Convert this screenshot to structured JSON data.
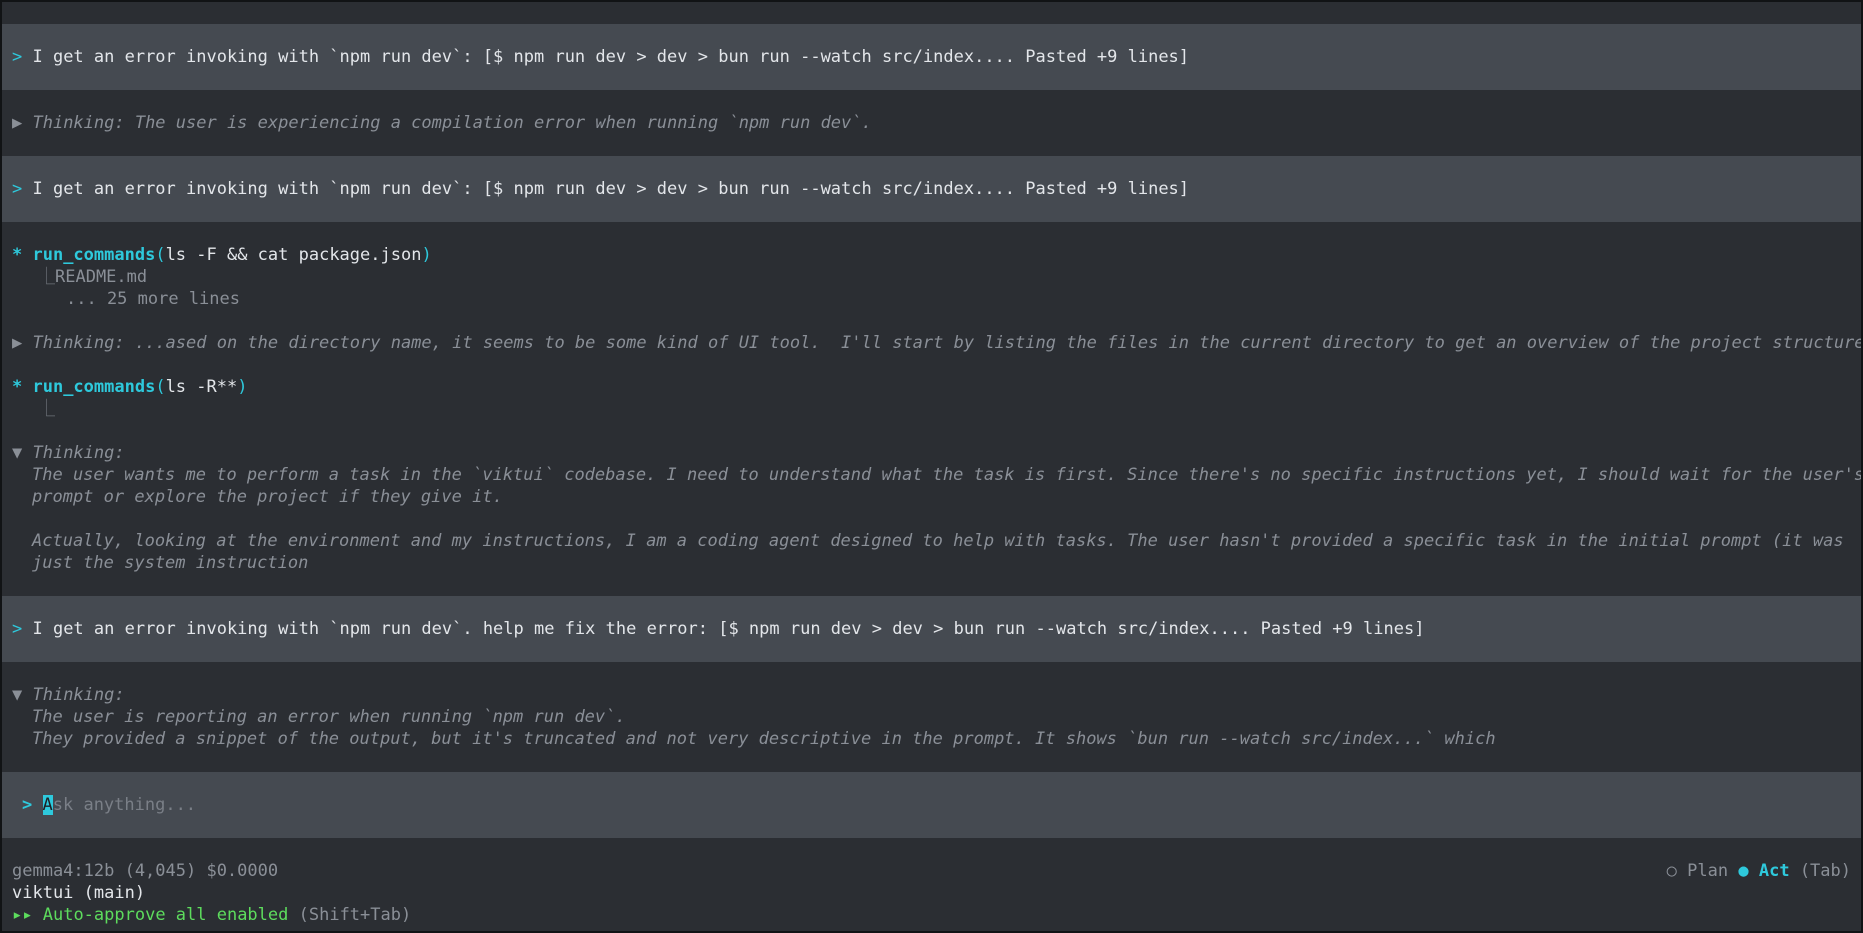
{
  "messages": {
    "user1": "I get an error invoking with `npm run dev`: [$ npm run dev > dev > bun run --watch src/index.... Pasted +9 lines]",
    "think1": "Thinking: The user is experiencing a compilation error when running `npm run dev`.",
    "user2": "I get an error invoking with `npm run dev`: [$ npm run dev > dev > bun run --watch src/index.... Pasted +9 lines]",
    "tool1_name": "run_commands",
    "tool1_args": "ls -F && cat package.json",
    "tool1_out1": "README.md",
    "tool1_out2": "... 25 more lines",
    "think2": "Thinking: ...ased on the directory name, it seems to be some kind of UI tool.  I'll start by listing the files in the current directory to get an overview of the project structure.",
    "tool2_name": "run_commands",
    "tool2_args": "ls -R**",
    "think3_head": "Thinking:",
    "think3_l1": "The user wants me to perform a task in the `viktui` codebase. I need to understand what the task is first. Since there's no specific instructions yet, I should wait for the user's",
    "think3_l2": "prompt or explore the project if they give it.",
    "think3_l3": "Actually, looking at the environment and my instructions, I am a coding agent designed to help with tasks. The user hasn't provided a specific task in the initial prompt (it was",
    "think3_l4": "just the system instruction",
    "user3": "I get an error invoking with `npm run dev`. help me fix the error: [$ npm run dev > dev > bun run --watch src/index.... Pasted +9 lines]",
    "think4_head": "Thinking:",
    "think4_l1": "The user is reporting an error when running `npm run dev`.",
    "think4_l2": "They provided a snippet of the output, but it's truncated and not very descriptive in the prompt. It shows `bun run --watch src/index...` which"
  },
  "prompt": {
    "caret": ">",
    "cursor_char": "A",
    "placeholder_rest": "sk anything..."
  },
  "status": {
    "model": "gemma4:12b (4,045) $0.0000",
    "project": "viktui (main)",
    "auto_approve_icon": "▸▸",
    "auto_approve": "Auto-approve all enabled",
    "auto_approve_key": "(Shift+Tab)",
    "mode_plan": "Plan",
    "mode_act": "Act",
    "mode_key": "(Tab)"
  },
  "colors": {
    "accent": "#2ec9dc",
    "success": "#5ddc5d",
    "band": "#454a51",
    "background": "#2b2e33"
  }
}
